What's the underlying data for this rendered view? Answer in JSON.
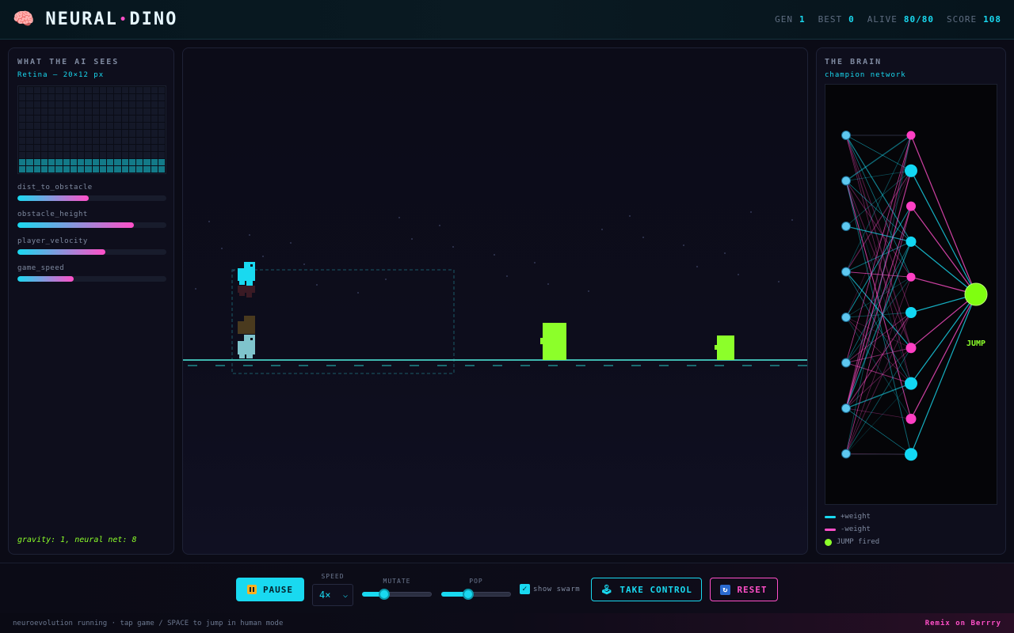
{
  "header": {
    "icon": "brain-icon",
    "icon_glyph": "🧠",
    "title_left": "NEURAL",
    "title_sep": "•",
    "title_right": "DINO",
    "stats": [
      {
        "label": "GEN",
        "value": "1"
      },
      {
        "label": "BEST",
        "value": "0"
      },
      {
        "label": "ALIVE",
        "value": "80/80"
      },
      {
        "label": "SCORE",
        "value": "108"
      }
    ]
  },
  "left_panel": {
    "heading": "WHAT THE AI SEES",
    "subheading": "Retina — 20×12 px",
    "retina": {
      "cols": 20,
      "rows": 12,
      "lit_rows": [
        10,
        11
      ]
    },
    "features": [
      {
        "label": "dist_to_obstacle",
        "value": 0.48
      },
      {
        "label": "obstacle_height",
        "value": 0.78
      },
      {
        "label": "player_velocity",
        "value": 0.59
      },
      {
        "label": "game_speed",
        "value": 0.38
      }
    ],
    "footnote": "gravity: 1, neural net: 8"
  },
  "right_panel": {
    "heading": "THE BRAIN",
    "subheading": "champion network",
    "output_label": "JUMP",
    "legend": [
      {
        "label": "+weight",
        "color": "#19d9f0"
      },
      {
        "label": "-weight",
        "color": "#ff4fc8"
      },
      {
        "label": "JUMP fired",
        "color": "#8cff2a"
      }
    ]
  },
  "controls": {
    "pause_icon": "pause-icon",
    "pause_label": "PAUSE",
    "speed_label": "SPEED",
    "speed_value": "4×",
    "mutate_label": "MUTATE",
    "mutate_value": 0.28,
    "pop_label": "POP",
    "pop_value": 0.37,
    "swarm_label": "show swarm",
    "swarm_checked": true,
    "take_control_icon": "joystick-icon",
    "take_control_label": "TAKE CONTROL",
    "reset_icon": "reset-icon",
    "reset_label": "RESET"
  },
  "statusbar": {
    "left": "neuroevolution running · tap game / SPACE to jump in human mode",
    "right": "Remix on Berrry"
  },
  "colors": {
    "accent": "#19d9f0",
    "pink": "#ff4fc8",
    "green": "#8cff2a"
  }
}
